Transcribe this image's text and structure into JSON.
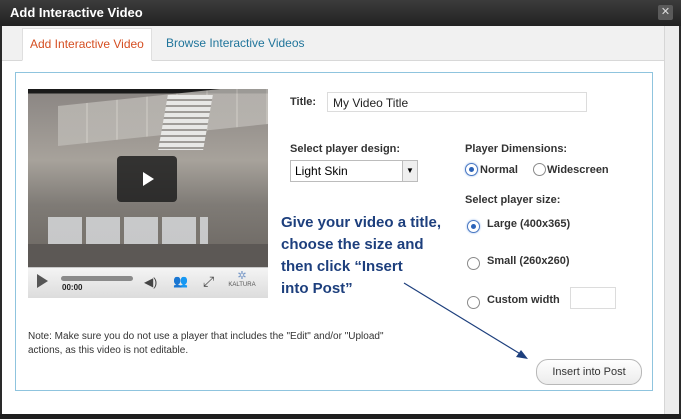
{
  "window": {
    "title": "Add Interactive Video",
    "close_symbol": "✕"
  },
  "tabs": [
    {
      "label": "Add Interactive Video",
      "active": true
    },
    {
      "label": "Browse Interactive Videos",
      "active": false
    }
  ],
  "player": {
    "time": "00:00",
    "brand": "KALTURA",
    "icons": [
      "play-icon",
      "volume-icon",
      "share-icon",
      "fullscreen-icon"
    ]
  },
  "form": {
    "title_label": "Title:",
    "title_value": "My Video Title",
    "design_label": "Select player design:",
    "design_value": "Light Skin",
    "dimensions_label": "Player Dimensions:",
    "dim_normal": "Normal",
    "dim_widescreen": "Widescreen",
    "size_label": "Select player size:",
    "size_large": "Large (400x365)",
    "size_small": "Small (260x260)",
    "size_custom": "Custom width",
    "custom_width_value": ""
  },
  "hint": {
    "line1": "Give your video a title,",
    "line2": "choose the size and",
    "line3": "then click “Insert",
    "line4": "into Post”"
  },
  "note": {
    "line1": "Note: Make sure you do not use a player that includes the \"Edit\" and/or \"Upload\"",
    "line2": "actions, as this video is not editable."
  },
  "insert_button": "Insert into Post",
  "colors": {
    "tab_active": "#d54e21",
    "tab_link": "#21759b",
    "hint_text": "#1d3f7d",
    "panel_border": "#8fc4de"
  }
}
